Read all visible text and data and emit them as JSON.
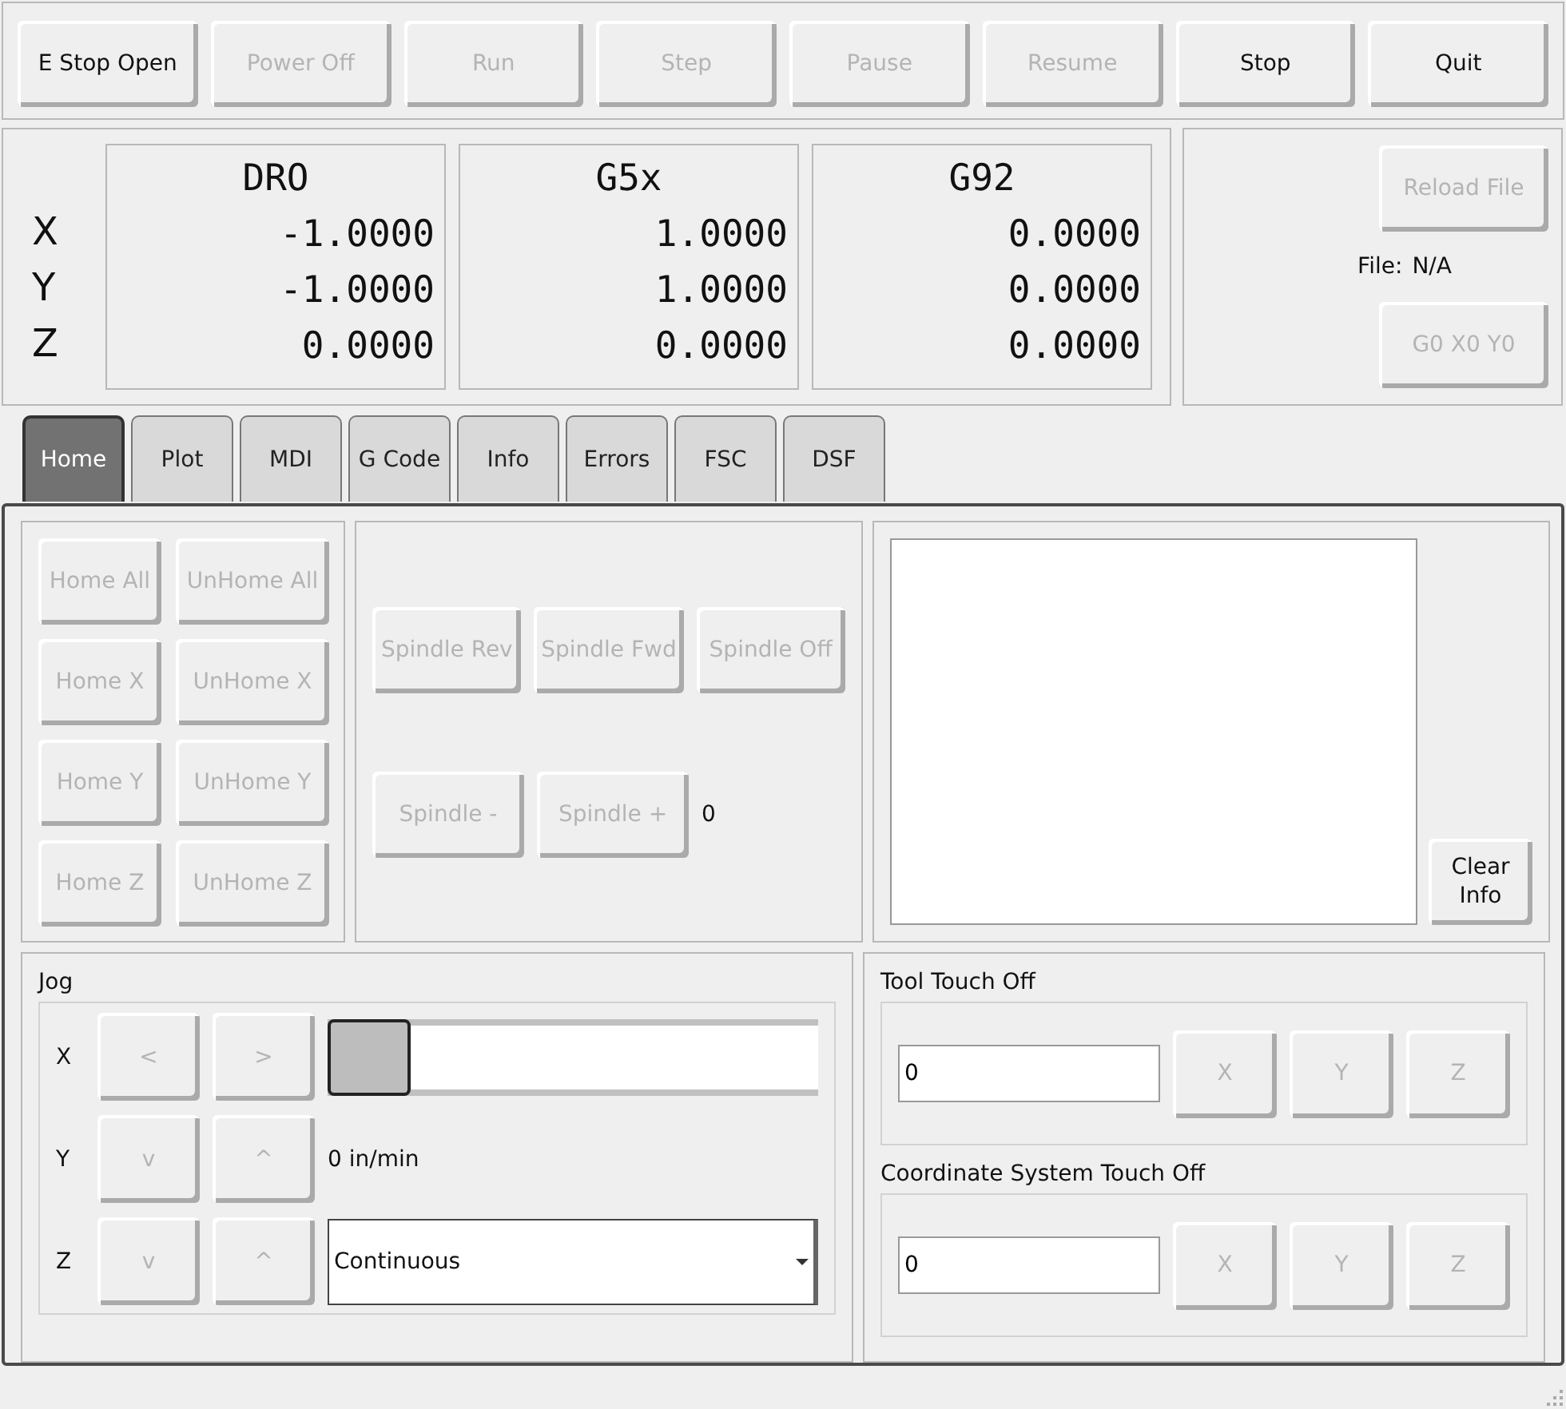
{
  "toolbar": [
    {
      "label": "E Stop Open",
      "disabled": false
    },
    {
      "label": "Power Off",
      "disabled": true
    },
    {
      "label": "Run",
      "disabled": true
    },
    {
      "label": "Step",
      "disabled": true
    },
    {
      "label": "Pause",
      "disabled": true
    },
    {
      "label": "Resume",
      "disabled": true
    },
    {
      "label": "Stop",
      "disabled": false
    },
    {
      "label": "Quit",
      "disabled": false
    }
  ],
  "dro": {
    "axes": [
      "X",
      "Y",
      "Z"
    ],
    "columns": [
      {
        "title": "DRO",
        "values": [
          "-1.0000",
          "-1.0000",
          "0.0000"
        ]
      },
      {
        "title": "G5x",
        "values": [
          "1.0000",
          "1.0000",
          "0.0000"
        ]
      },
      {
        "title": "G92",
        "values": [
          "0.0000",
          "0.0000",
          "0.0000"
        ]
      }
    ]
  },
  "file_panel": {
    "reload_button": {
      "label": "Reload File",
      "disabled": true
    },
    "file_label": "File:",
    "file_value": "N/A",
    "g0_button": {
      "label": "G0 X0 Y0",
      "disabled": true
    }
  },
  "tabs": [
    {
      "label": "Home",
      "selected": true
    },
    {
      "label": "Plot",
      "selected": false
    },
    {
      "label": "MDI",
      "selected": false
    },
    {
      "label": "G Code",
      "selected": false
    },
    {
      "label": "Info",
      "selected": false
    },
    {
      "label": "Errors",
      "selected": false
    },
    {
      "label": "FSC",
      "selected": false
    },
    {
      "label": "DSF",
      "selected": false
    }
  ],
  "home_buttons": [
    {
      "label": "Home All",
      "disabled": true
    },
    {
      "label": "UnHome All",
      "disabled": true
    },
    {
      "label": "Home X",
      "disabled": true
    },
    {
      "label": "UnHome X",
      "disabled": true
    },
    {
      "label": "Home Y",
      "disabled": true
    },
    {
      "label": "UnHome Y",
      "disabled": true
    },
    {
      "label": "Home Z",
      "disabled": true
    },
    {
      "label": "UnHome Z",
      "disabled": true
    }
  ],
  "spindle": {
    "row1": [
      {
        "label": "Spindle Rev",
        "disabled": true
      },
      {
        "label": "Spindle Fwd",
        "disabled": true
      },
      {
        "label": "Spindle Off",
        "disabled": true
      }
    ],
    "row2": [
      {
        "label": "Spindle -",
        "disabled": true
      },
      {
        "label": "Spindle +",
        "disabled": true
      }
    ],
    "speed": "0"
  },
  "info": {
    "clear_button": {
      "label": "Clear Info",
      "disabled": false
    }
  },
  "jog": {
    "title": "Jog",
    "rows": [
      {
        "axis": "X",
        "kind": "slider",
        "buttons": [
          {
            "label": "<",
            "disabled": true
          },
          {
            "label": ">",
            "disabled": true
          }
        ],
        "level": 0
      },
      {
        "axis": "Y",
        "kind": "reading",
        "buttons": [
          {
            "label": "v",
            "disabled": true
          },
          {
            "label": "^",
            "disabled": true
          }
        ],
        "reading": "0 in/min"
      },
      {
        "axis": "Z",
        "kind": "dropdown",
        "buttons": [
          {
            "label": "v",
            "disabled": true
          },
          {
            "label": "^",
            "disabled": true
          }
        ],
        "value": "Continuous"
      }
    ]
  },
  "touch_off": [
    {
      "title": "Tool Touch Off",
      "value": "0",
      "buttons": [
        {
          "label": "X",
          "disabled": true
        },
        {
          "label": "Y",
          "disabled": true
        },
        {
          "label": "Z",
          "disabled": true
        }
      ]
    },
    {
      "title": "Coordinate System Touch Off",
      "value": "0",
      "buttons": [
        {
          "label": "X",
          "disabled": true
        },
        {
          "label": "Y",
          "disabled": true
        },
        {
          "label": "Z",
          "disabled": true
        }
      ]
    }
  ]
}
